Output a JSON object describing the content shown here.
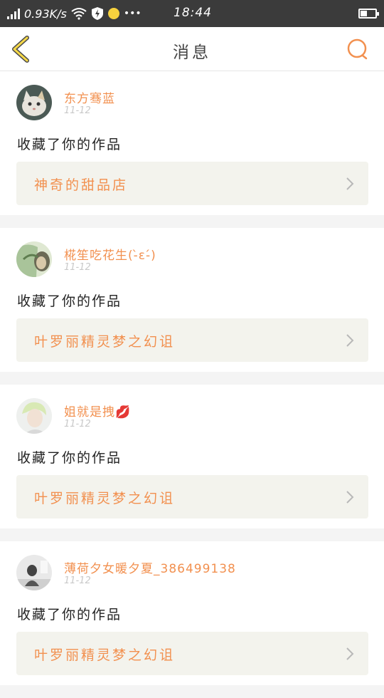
{
  "status_bar": {
    "net_speed": "0.93K/s",
    "time": "18:44",
    "more": "•••"
  },
  "header": {
    "title": "消息"
  },
  "messages": [
    {
      "user": "东方骞蓝",
      "date": "11-12",
      "action": "收藏了你的作品",
      "work": "神奇的甜品店"
    },
    {
      "user": "椛笙吃花生(-̀ε-́)",
      "date": "11-12",
      "action": "收藏了你的作品",
      "work": "叶罗丽精灵梦之幻诅"
    },
    {
      "user": "姐就是拽💋",
      "date": "11-12",
      "action": "收藏了你的作品",
      "work": "叶罗丽精灵梦之幻诅"
    },
    {
      "user": "薄荷夕女暖夕夏_386499138",
      "date": "11-12",
      "action": "收藏了你的作品",
      "work": "叶罗丽精灵梦之幻诅"
    }
  ],
  "colors": {
    "accent": "#f2904f",
    "status_bar_bg": "#3b3b3b",
    "link_bg": "#f3f3ed"
  }
}
